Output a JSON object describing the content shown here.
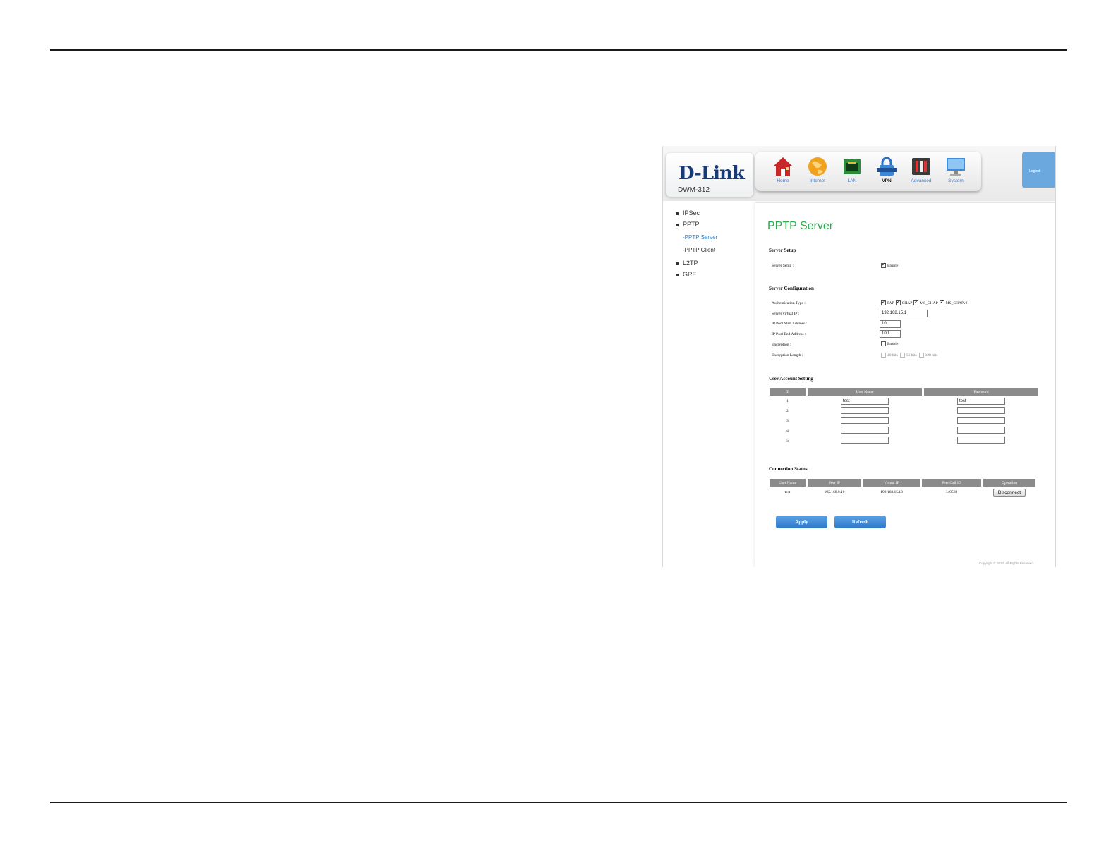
{
  "brand": {
    "name": "D-Link",
    "model": "DWM-312"
  },
  "nav": [
    {
      "label": "Home",
      "icon": "house-icon"
    },
    {
      "label": "Internet",
      "icon": "globe-icon"
    },
    {
      "label": "LAN",
      "icon": "ethernet-port-icon"
    },
    {
      "label": "VPN",
      "icon": "padlock-icon",
      "active": true
    },
    {
      "label": "Advanced",
      "icon": "tools-icon"
    },
    {
      "label": "System",
      "icon": "monitor-icon"
    }
  ],
  "logout": "Logout",
  "sidebar": {
    "ipsec": "IPSec",
    "pptp": "PPTP",
    "pptp_server": "-PPTP Server",
    "pptp_client": "-PPTP Client",
    "l2tp": "L2TP",
    "gre": "GRE"
  },
  "page": {
    "title": "PPTP Server",
    "server_setup": {
      "heading": "Server Setup",
      "label": "Server Setup :",
      "enable": "Enable"
    },
    "server_config": {
      "heading": "Server Configuration",
      "auth_label": "Authentication Type :",
      "pap": "PAP",
      "chap": "CHAP",
      "ms_chap": "MS_CHAP",
      "ms_chapv2": "MS_CHAPv2",
      "virtual_ip_label": "Server virtual IP :",
      "virtual_ip": "192.168.15.1",
      "pool_start_label": "IP Pool Start Address :",
      "pool_start": "10",
      "pool_end_label": "IP Pool End Address :",
      "pool_end": "100",
      "encryption_label": "Encryption :",
      "encryption_enable": "Enable",
      "enc_length_label": "Encryption Length :",
      "bits40": "40 bits",
      "bits56": "56 bits",
      "bits128": "128 bits"
    },
    "users": {
      "heading": "User Account Setting",
      "col_id": "ID",
      "col_user": "User Name",
      "col_pass": "Password",
      "rows": [
        {
          "id": "1",
          "user": "test",
          "pass": "test"
        },
        {
          "id": "2",
          "user": "",
          "pass": ""
        },
        {
          "id": "3",
          "user": "",
          "pass": ""
        },
        {
          "id": "4",
          "user": "",
          "pass": ""
        },
        {
          "id": "5",
          "user": "",
          "pass": ""
        }
      ]
    },
    "status": {
      "heading": "Connection Status",
      "col_user": "User Name",
      "col_peer_ip": "Peer IP",
      "col_virtual_ip": "Virtual IP",
      "col_call_id": "Peer Call ID",
      "col_operation": "Operation",
      "row": {
        "user": "test",
        "peer_ip": "192.168.0.10",
        "virtual_ip": "192.168.15.10",
        "call_id": "149569",
        "operation": "Disconnect"
      }
    },
    "apply": "Apply",
    "refresh": "Refresh",
    "copyright": "Copyright © 2013. All Rights Reserved."
  }
}
